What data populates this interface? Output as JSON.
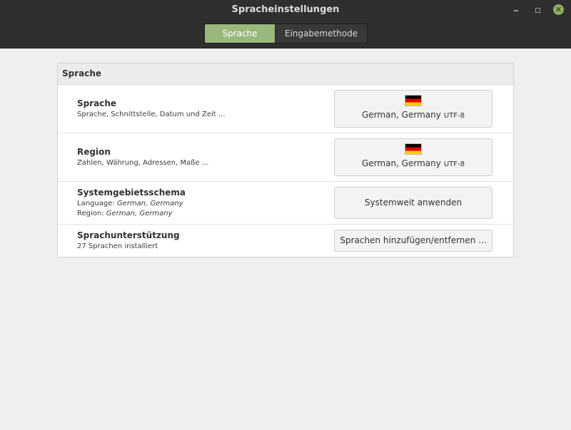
{
  "window": {
    "title": "Spracheinstellungen",
    "close_glyph": "✕"
  },
  "tabs": [
    {
      "label": "Sprache",
      "active": true
    },
    {
      "label": "Eingabemethode",
      "active": false
    }
  ],
  "panel": {
    "header": "Sprache",
    "rows": {
      "language": {
        "title": "Sprache",
        "subtitle": "Sprache, Schnittstelle, Datum und Zeit ...",
        "button_label": "German, Germany",
        "button_encoding": "UTF-8",
        "flag_icon": "flag-germany-icon"
      },
      "region": {
        "title": "Region",
        "subtitle": "Zahlen, Währung, Adressen, Maße ...",
        "button_label": "German, Germany",
        "button_encoding": "UTF-8",
        "flag_icon": "flag-germany-icon"
      },
      "system_locale": {
        "title": "Systemgebietsschema",
        "language_label": "Language:",
        "language_value": "German, Germany",
        "region_label": "Region:",
        "region_value": "German, Germany",
        "button_label": "Systemweit anwenden"
      },
      "language_support": {
        "title": "Sprachunterstützung",
        "subtitle": "27 Sprachen installiert",
        "button_label": "Sprachen hinzufügen/entfernen ..."
      }
    }
  },
  "colors": {
    "accent": "#9ab87c",
    "titlebar": "#2f2f2f",
    "close_button": "#8fb060"
  }
}
